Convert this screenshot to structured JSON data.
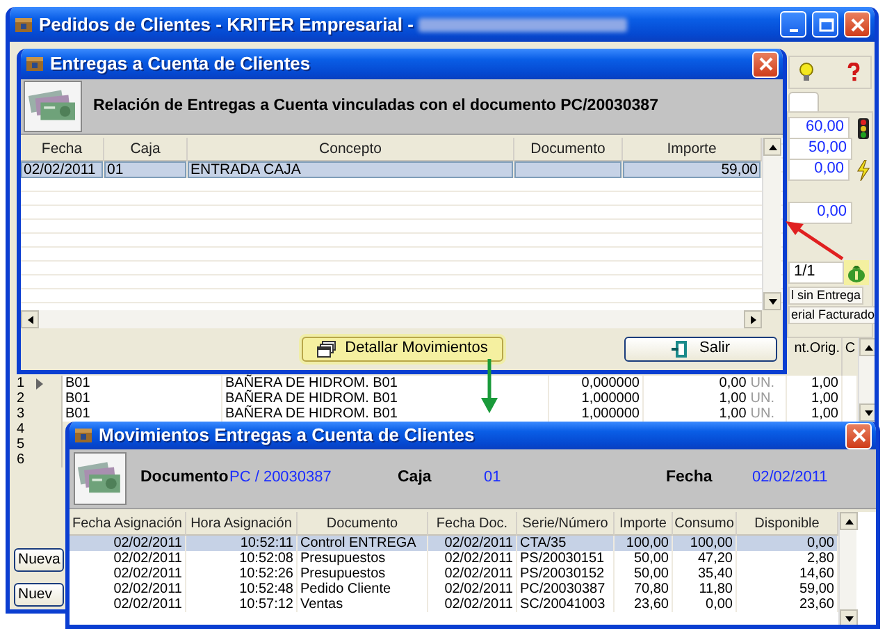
{
  "main_window": {
    "title": "Pedidos de Clientes - KRITER Empresarial -",
    "summary_values": [
      "60,00",
      "50,00",
      "0,00",
      "0,00"
    ],
    "page_counter": "1/1",
    "options": [
      "l sin Entrega",
      "erial Facturado"
    ],
    "grid": {
      "columns": [
        "nt.Orig.",
        "C"
      ],
      "rows": [
        {
          "num": "1",
          "current": true,
          "code": "B01",
          "desc": "BAÑERA DE HIDROM. B01",
          "qty": "0,000000",
          "amount": "0,00",
          "unit": "UN.",
          "orig": "1,00"
        },
        {
          "num": "2",
          "current": false,
          "code": "B01",
          "desc": "BAÑERA DE HIDROM. B01",
          "qty": "1,000000",
          "amount": "1,00",
          "unit": "UN.",
          "orig": "1,00"
        },
        {
          "num": "3",
          "current": false,
          "code": "B01",
          "desc": "BAÑERA DE HIDROM. B01",
          "qty": "1,000000",
          "amount": "1,00",
          "unit": "UN.",
          "orig": "1,00"
        },
        {
          "num": "4",
          "current": false
        },
        {
          "num": "5",
          "current": false
        },
        {
          "num": "6",
          "current": false
        }
      ]
    },
    "buttons": [
      "Nueva",
      "Nuev"
    ]
  },
  "deliveries_dialog": {
    "title": "Entregas a Cuenta de Clientes",
    "heading": "Relación de Entregas a Cuenta vinculadas con el documento PC/20030387",
    "columns": [
      "Fecha",
      "Caja",
      "Concepto",
      "Documento",
      "Importe"
    ],
    "rows": [
      {
        "fecha": "02/02/2011",
        "caja": "01",
        "concepto": "ENTRADA CAJA",
        "importe": "59,00",
        "selected": true
      }
    ],
    "buttons": [
      "Detallar Movimientos",
      "Salir"
    ]
  },
  "movements_dialog": {
    "title": "Movimientos Entregas a Cuenta de Clientes",
    "fields": [
      {
        "label": "Documento",
        "value": "PC / 20030387"
      },
      {
        "label": "Caja",
        "value": "01"
      },
      {
        "label": "Fecha",
        "value": "02/02/2011"
      }
    ],
    "columns": [
      "Fecha Asignación",
      "Hora Asignación",
      "Documento",
      "Fecha Doc.",
      "Serie/Número",
      "Importe",
      "Consumo",
      "Disponible"
    ],
    "rows": [
      {
        "cells": [
          "02/02/2011",
          "10:52:11",
          "Control ENTREGA",
          "02/02/2011",
          "CTA/35",
          "100,00",
          "100,00",
          "0,00"
        ],
        "selected": true
      },
      {
        "cells": [
          "02/02/2011",
          "10:52:08",
          "Presupuestos",
          "02/02/2011",
          "PS/20030151",
          "50,00",
          "47,20",
          "2,80"
        ],
        "selected": false
      },
      {
        "cells": [
          "02/02/2011",
          "10:52:26",
          "Presupuestos",
          "02/02/2011",
          "PS/20030152",
          "50,00",
          "35,40",
          "14,60"
        ],
        "selected": false
      },
      {
        "cells": [
          "02/02/2011",
          "10:52:48",
          "Pedido Cliente",
          "02/02/2011",
          "PC/20030387",
          "70,80",
          "11,80",
          "59,00"
        ],
        "selected": false
      },
      {
        "cells": [
          "02/02/2011",
          "10:57:12",
          "Ventas",
          "02/02/2011",
          "SC/20041003",
          "23,60",
          "0,00",
          "23,60"
        ],
        "selected": false
      }
    ]
  }
}
